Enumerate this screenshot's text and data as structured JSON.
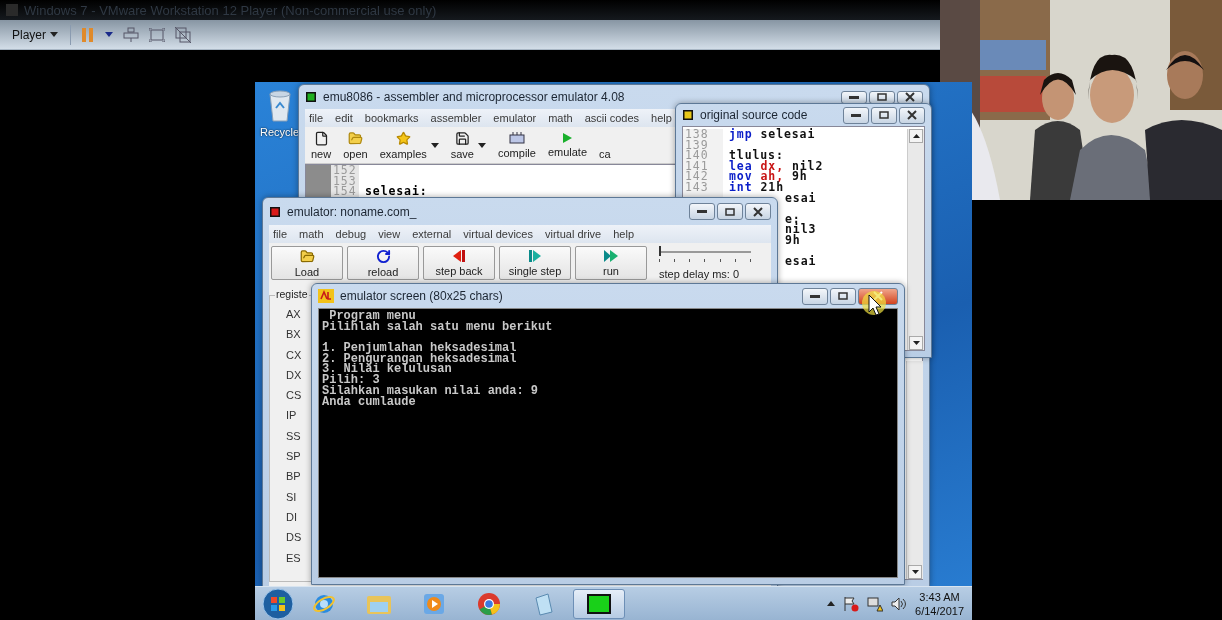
{
  "vmware": {
    "title": "Windows 7 - VMware Workstation 12 Player (Non-commercial use only)",
    "menu_label": "Player"
  },
  "desktop_icons": [
    {
      "label": "Recycle"
    }
  ],
  "main_window": {
    "title": "emu8086 - assembler and microprocessor emulator 4.08",
    "menu": [
      "file",
      "edit",
      "bookmarks",
      "assembler",
      "emulator",
      "math",
      "ascii codes",
      "help"
    ],
    "toolbar": [
      {
        "label": "new",
        "kind": "new",
        "dropdown": false
      },
      {
        "label": "open",
        "kind": "open",
        "dropdown": false
      },
      {
        "label": "examples",
        "kind": "examples",
        "dropdown": true
      },
      {
        "label": "save",
        "kind": "save",
        "dropdown": true
      },
      {
        "label": "compile",
        "kind": "compile",
        "dropdown": false
      },
      {
        "label": "emulate",
        "kind": "emulate",
        "dropdown": false
      },
      {
        "label": "ca",
        "kind": "calculator",
        "dropdown": false
      }
    ],
    "lines": [
      {
        "number": "152"
      },
      {
        "number": "153"
      },
      {
        "number": "154",
        "text": "selesai:"
      }
    ]
  },
  "source_window": {
    "title": "original source code",
    "lines": [
      {
        "kind": "full",
        "number": "138",
        "tokens": [
          {
            "text": "jmp",
            "kind": "keyword"
          },
          {
            "text": "selesai",
            "kind": "plain"
          }
        ]
      },
      {
        "kind": "full",
        "number": "139"
      },
      {
        "kind": "full",
        "number": "140",
        "tokens": [
          {
            "text": "tlulus:",
            "kind": "plain"
          }
        ]
      },
      {
        "kind": "full",
        "number": "141",
        "tokens": [
          {
            "text": "lea",
            "kind": "keyword"
          },
          {
            "text": "dx,",
            "kind": "register"
          },
          {
            "text": "nil2",
            "kind": "plain"
          }
        ]
      },
      {
        "kind": "full",
        "number": "142",
        "tokens": [
          {
            "text": "mov",
            "kind": "keyword"
          },
          {
            "text": "ah,",
            "kind": "register"
          },
          {
            "text": "9h",
            "kind": "plain"
          }
        ]
      },
      {
        "kind": "full",
        "number": "143",
        "tokens": [
          {
            "text": "int",
            "kind": "keyword"
          },
          {
            "text": "21h",
            "kind": "plain"
          }
        ]
      },
      {
        "kind": "partial",
        "text": "esai"
      },
      {
        "kind": "partial"
      },
      {
        "kind": "partial",
        "text": "e:"
      },
      {
        "kind": "partial",
        "text": "nil3"
      },
      {
        "kind": "partial",
        "text": "9h"
      },
      {
        "kind": "partial"
      },
      {
        "kind": "partial",
        "text": "esai"
      }
    ]
  },
  "emulator_window": {
    "title": "emulator: noname.com_",
    "menu": [
      "file",
      "math",
      "debug",
      "view",
      "external",
      "virtual devices",
      "virtual drive",
      "help"
    ],
    "buttons": [
      {
        "label": "Load",
        "kind": "load"
      },
      {
        "label": "reload",
        "kind": "reload"
      },
      {
        "label": "step back",
        "kind": "step_back"
      },
      {
        "label": "single step",
        "kind": "single_step"
      },
      {
        "label": "run",
        "kind": "run"
      }
    ],
    "step_delay": {
      "label": "step delay ms: 0",
      "level": 0
    },
    "registers": {
      "title": "registe",
      "names": [
        "AX",
        "BX",
        "CX",
        "DX",
        "CS",
        "IP",
        "SS",
        "SP",
        "BP",
        "SI",
        "DI",
        "DS",
        "ES"
      ]
    }
  },
  "screen_window": {
    "title": "emulator screen (80x25 chars)",
    "close_hovered": true,
    "lines": [
      {
        "kind": "text",
        "text": " Program menu"
      },
      {
        "kind": "text",
        "text": "Pilihlah salah satu menu berikut"
      },
      {
        "kind": "blank"
      },
      {
        "kind": "text",
        "text": "1. Penjumlahan heksadesimal"
      },
      {
        "kind": "text",
        "text": "2. Pengurangan heksadesimal"
      },
      {
        "kind": "text",
        "text": "3. Nilai kelulusan"
      },
      {
        "kind": "text",
        "text": "Pilih: 3"
      },
      {
        "kind": "text",
        "text": "Silahkan masukan nilai anda: 9"
      },
      {
        "kind": "text",
        "text": "Anda cumlaude"
      }
    ]
  },
  "taskbar": {
    "items": [
      {
        "kind": "ie",
        "selected": false
      },
      {
        "kind": "explorer",
        "selected": false
      },
      {
        "kind": "media",
        "selected": false
      },
      {
        "kind": "chrome",
        "selected": false
      },
      {
        "kind": "notepad",
        "selected": false
      },
      {
        "kind": "chip",
        "selected": true
      }
    ],
    "time": "3:43 AM",
    "date": "6/14/2017"
  }
}
